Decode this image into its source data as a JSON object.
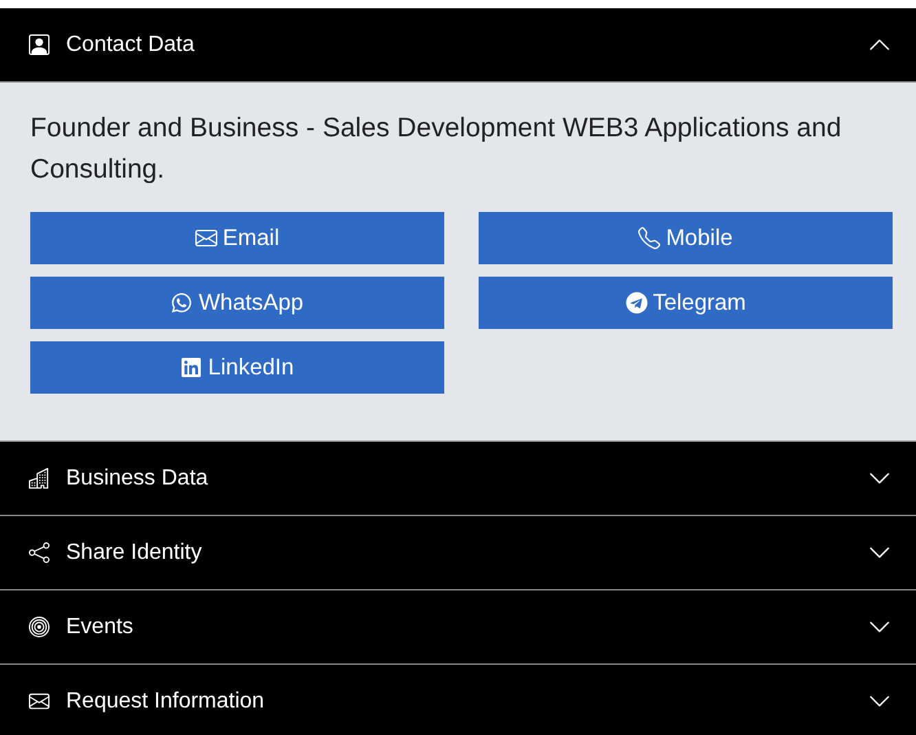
{
  "sections": [
    {
      "kind": "contact",
      "title": "Contact Data",
      "expanded": true,
      "description": "Founder and Business - Sales Development WEB3 Applications and Consulting.",
      "buttons": [
        {
          "kind": "email",
          "label": "Email"
        },
        {
          "kind": "mobile",
          "label": "Mobile"
        },
        {
          "kind": "whatsapp",
          "label": "WhatsApp"
        },
        {
          "kind": "telegram",
          "label": "Telegram"
        },
        {
          "kind": "linkedin",
          "label": "LinkedIn"
        }
      ]
    },
    {
      "kind": "business",
      "title": "Business Data",
      "expanded": false
    },
    {
      "kind": "share",
      "title": "Share Identity",
      "expanded": false
    },
    {
      "kind": "events",
      "title": "Events",
      "expanded": false
    },
    {
      "kind": "request",
      "title": "Request Information",
      "expanded": false
    }
  ]
}
